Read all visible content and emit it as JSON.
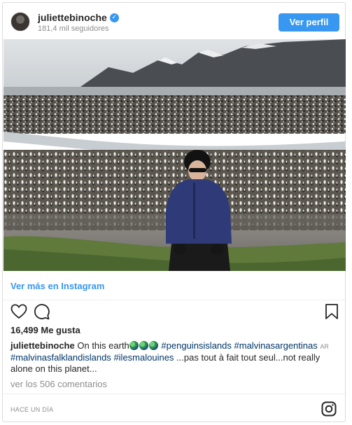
{
  "header": {
    "username": "juliettebinoche",
    "followers": "181,4 mil seguidores",
    "follow_label": "Ver perfil"
  },
  "view_more": "Ver más en Instagram",
  "likes": "16,499 Me gusta",
  "caption": {
    "username": "juliettebinoche",
    "text_start": "On this earth",
    "globe_icons": 3,
    "tag_1": "#penguinsislands",
    "tag_2": "#malvinasargentinas",
    "badge": "AR",
    "tag_3": "#malvinasfalklandislands",
    "tag_4": "#ilesmalouines",
    "text_end": "...pas tout à fait tout seul...not really alone on this planet..."
  },
  "comments": "ver los 506 comentarios",
  "timestamp": "HACE UN DÍA",
  "colors": {
    "accent": "#3897f0",
    "hashtag": "#003569",
    "muted": "#8e8e8e"
  }
}
